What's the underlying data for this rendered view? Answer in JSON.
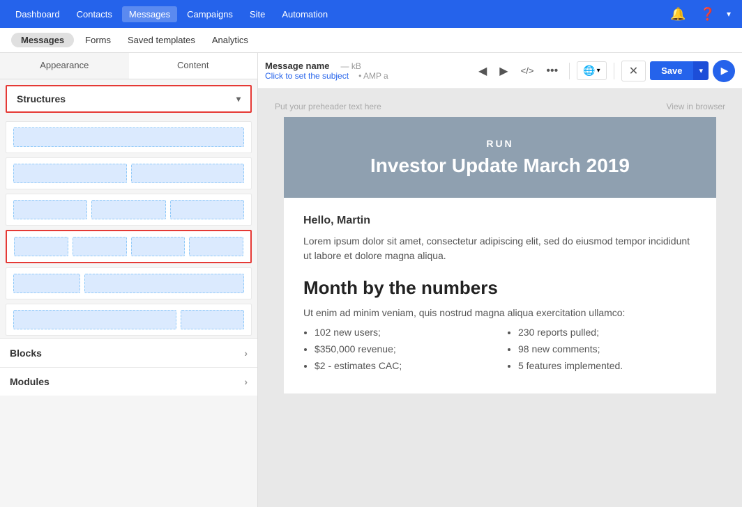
{
  "nav": {
    "brand_color": "#2563eb",
    "items": [
      {
        "label": "Dashboard",
        "active": false
      },
      {
        "label": "Contacts",
        "active": false
      },
      {
        "label": "Messages",
        "active": true
      },
      {
        "label": "Campaigns",
        "active": false
      },
      {
        "label": "Site",
        "active": false
      },
      {
        "label": "Automation",
        "active": false
      }
    ],
    "icons": {
      "bell": "🔔",
      "help": "❓",
      "dropdown": "▾"
    }
  },
  "subnav": {
    "items": [
      {
        "label": "Messages",
        "pill": true
      },
      {
        "label": "Forms"
      },
      {
        "label": "Saved templates"
      },
      {
        "label": "Analytics"
      }
    ]
  },
  "left_panel": {
    "tabs": [
      {
        "label": "Appearance",
        "active": true
      },
      {
        "label": "Content",
        "active": false
      }
    ],
    "structures": {
      "label": "Structures",
      "chevron": "▾",
      "rows": [
        {
          "type": "single",
          "blocks": [
            1
          ]
        },
        {
          "type": "two-col",
          "blocks": [
            1,
            1
          ]
        },
        {
          "type": "three-col",
          "blocks": [
            1,
            1,
            1
          ]
        },
        {
          "type": "four-col",
          "blocks": [
            1,
            1,
            1,
            1
          ],
          "selected": true
        },
        {
          "type": "sidebar-left",
          "blocks": [
            0.35,
            0.65
          ]
        },
        {
          "type": "sidebar-right",
          "blocks": [
            0.65,
            0.35
          ]
        }
      ]
    },
    "blocks": {
      "label": "Blocks",
      "chevron": "›"
    },
    "modules": {
      "label": "Modules",
      "chevron": "›"
    }
  },
  "toolbar": {
    "message_name": "Message name",
    "meta_size": "— kB",
    "meta_amp": "AMP a",
    "subject_placeholder": "Click to set the subject",
    "icons": {
      "undo": "◀",
      "redo": "▶",
      "code": "</>",
      "more": "•••",
      "globe": "🌐",
      "chevron_down": "▾",
      "close": "✕"
    },
    "save_label": "Save",
    "play_icon": "▶"
  },
  "preview": {
    "preheader_placeholder": "Put your preheader text here",
    "view_in_browser": "View in browser",
    "email": {
      "run_label": "RUN",
      "title": "Investor Update March 2019",
      "greeting": "Hello, Martin",
      "intro": "Lorem ipsum dolor sit amet, consectetur adipiscing elit, sed do eiusmod tempor incididunt ut labore et dolore magna aliqua.",
      "section_title": "Month by the numbers",
      "section_intro": "Ut enim ad minim veniam, quis nostrud magna aliqua exercitation ullamco:",
      "col1_items": [
        "102 new users;",
        "$350,000 revenue;",
        "$2 - estimates CAC;"
      ],
      "col2_items": [
        "230 reports pulled;",
        "98 new comments;",
        "5 features implemented."
      ]
    }
  }
}
